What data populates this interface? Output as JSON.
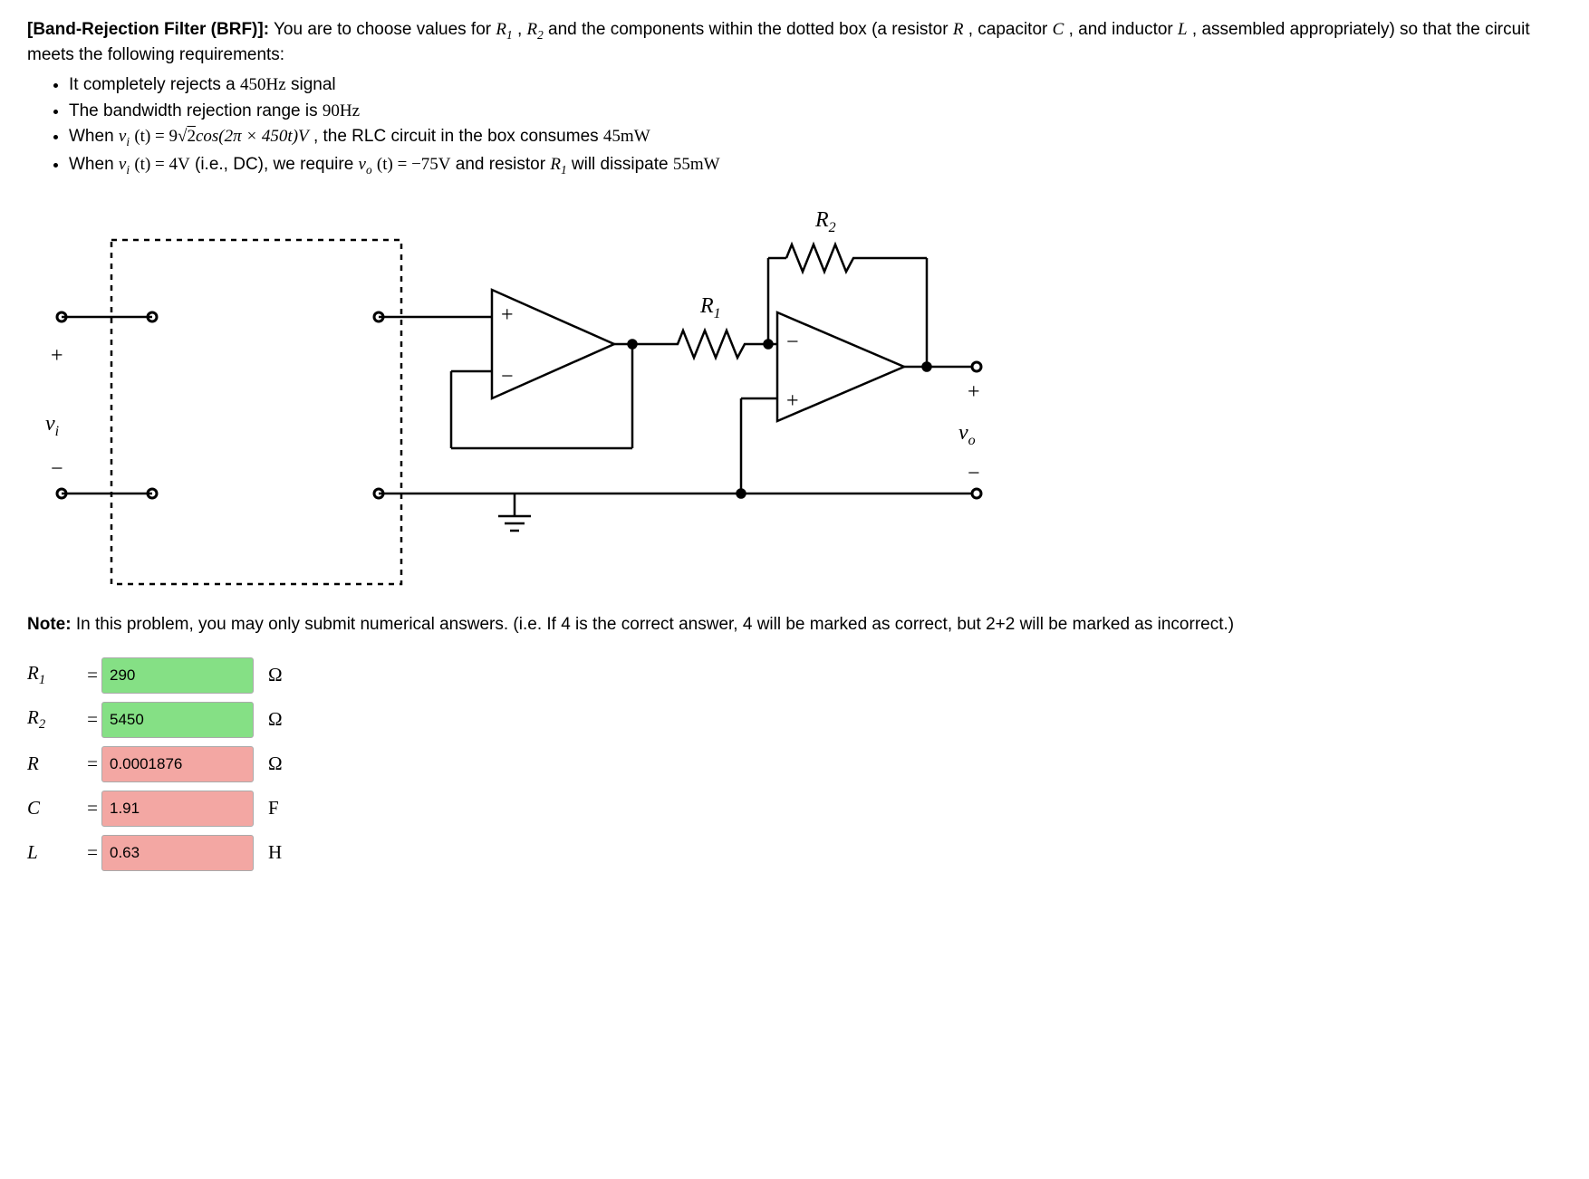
{
  "title_tag": "[Band-Rejection Filter (BRF)]:",
  "intro_part1": " You are to choose values for ",
  "intro_R1": "R",
  "intro_R1_sub": "1",
  "intro_comma": " , ",
  "intro_R2": "R",
  "intro_R2_sub": "2",
  "intro_part2": " and the components within the dotted box (a resistor ",
  "intro_R": "R",
  "intro_part3": ", capacitor ",
  "intro_C": "C",
  "intro_part4": ", and inductor ",
  "intro_L": "L",
  "intro_part5": ", assembled appropriately) so that the circuit meets the following requirements:",
  "bullets": {
    "b1_a": "It completely rejects a ",
    "b1_val": "450Hz",
    "b1_b": " signal",
    "b2_a": "The bandwidth rejection range is ",
    "b2_val": "90Hz",
    "b3_a": "When ",
    "b3_vt": "v",
    "b3_vt_sub": "i",
    "b3_vt_arg": "(t) = 9",
    "b3_sqrt2": "2",
    "b3_cos": "cos(2π × 450t)V",
    "b3_b": ", the RLC circuit in the box consumes ",
    "b3_val": "45mW",
    "b4_a": "When ",
    "b4_vt": "v",
    "b4_vt_sub": "i",
    "b4_vt_arg": "(t) = 4V",
    "b4_b": " (i.e., DC), we require ",
    "b4_vo": "v",
    "b4_vo_sub": "o",
    "b4_vo_arg": "(t) = −75V",
    "b4_c": " and resistor ",
    "b4_R1": "R",
    "b4_R1_sub": "1",
    "b4_d": " will dissipate ",
    "b4_val": "55mW"
  },
  "circuit_labels": {
    "R2": "R",
    "R2_sub": "2",
    "R1": "R",
    "R1_sub": "1",
    "vi": "v",
    "vi_sub": "i",
    "vo": "v",
    "vo_sub": "o",
    "plus": "+",
    "minus": "−"
  },
  "note_b": "Note:",
  "note_text": " In this problem, you may only submit numerical answers. (i.e. If 4 is the correct answer, 4 will be marked as correct, but 2+2 will be marked as incorrect.)",
  "answers": {
    "R1": {
      "label_sym": "R",
      "label_sub": "1",
      "value": "290",
      "unit": "Ω",
      "status": "correct"
    },
    "R2": {
      "label_sym": "R",
      "label_sub": "2",
      "value": "5450",
      "unit": "Ω",
      "status": "correct"
    },
    "R": {
      "label_sym": "R",
      "label_sub": "",
      "value": "0.0001876",
      "unit": "Ω",
      "status": "incorrect"
    },
    "C": {
      "label_sym": "C",
      "label_sub": "",
      "value": "1.91",
      "unit": "F",
      "status": "incorrect"
    },
    "L": {
      "label_sym": "L",
      "label_sub": "",
      "value": "0.63",
      "unit": "H",
      "status": "incorrect"
    }
  }
}
